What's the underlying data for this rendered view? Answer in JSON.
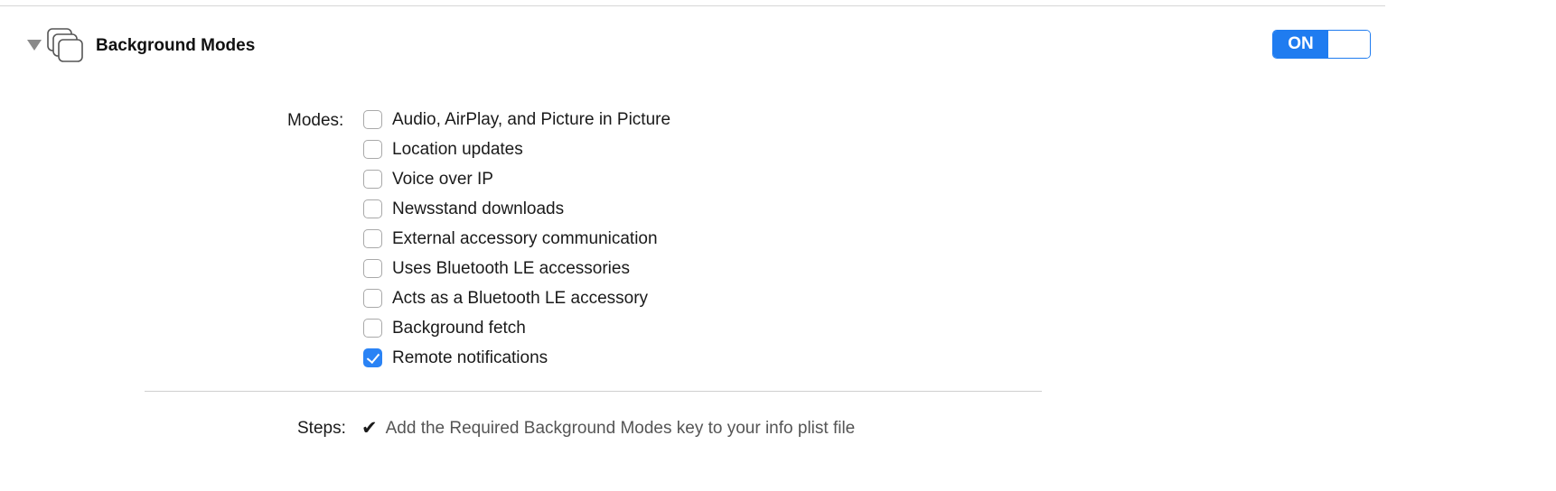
{
  "section": {
    "title": "Background Modes",
    "toggle_on_label": "ON",
    "toggle_state": "on"
  },
  "modes": {
    "label": "Modes:",
    "items": [
      {
        "label": "Audio, AirPlay, and Picture in Picture",
        "checked": false
      },
      {
        "label": "Location updates",
        "checked": false
      },
      {
        "label": "Voice over IP",
        "checked": false
      },
      {
        "label": "Newsstand downloads",
        "checked": false
      },
      {
        "label": "External accessory communication",
        "checked": false
      },
      {
        "label": "Uses Bluetooth LE accessories",
        "checked": false
      },
      {
        "label": "Acts as a Bluetooth LE accessory",
        "checked": false
      },
      {
        "label": "Background fetch",
        "checked": false
      },
      {
        "label": "Remote notifications",
        "checked": true
      }
    ]
  },
  "steps": {
    "label": "Steps:",
    "items": [
      {
        "label": "Add the Required Background Modes key to your info plist file",
        "done": true
      }
    ]
  },
  "icons": {
    "disclosure": "disclosure-triangle-icon",
    "capability": "stacked-windows-icon",
    "checkmark": "checkmark-icon"
  },
  "colors": {
    "accent": "#1f7cf0",
    "checkbox_checked": "#2a83f5"
  }
}
